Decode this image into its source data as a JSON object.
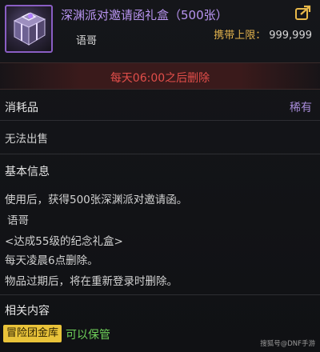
{
  "item": {
    "title": "深渊派对邀请函礼盒（500张）",
    "carry_label": "携带上限：",
    "carry_value": "999,999",
    "owner": "语哥",
    "icon": "purple-gift-box-icon",
    "title_color": "#b894f0"
  },
  "expiry": {
    "text": "每天06:00之后删除",
    "color": "#e24e4a"
  },
  "category": {
    "label": "消耗品",
    "rarity": "稀有",
    "rarity_color": "#a78bd8"
  },
  "trade": {
    "text": "无法出售"
  },
  "basic_info": {
    "heading": "基本信息",
    "lines": [
      "使用后，获得500张深渊派对邀请函。",
      "语哥",
      "<达成55级的纪念礼盒>",
      "每天凌晨6点删除。",
      "物品过期后，将在重新登录时删除。"
    ]
  },
  "related": {
    "heading": "相关内容",
    "badge": "冒险团金库",
    "badge_color": "#e9c33a",
    "status": "可以保管",
    "status_color": "#6fd15a"
  },
  "watermark": "搜狐号@DNF手游"
}
